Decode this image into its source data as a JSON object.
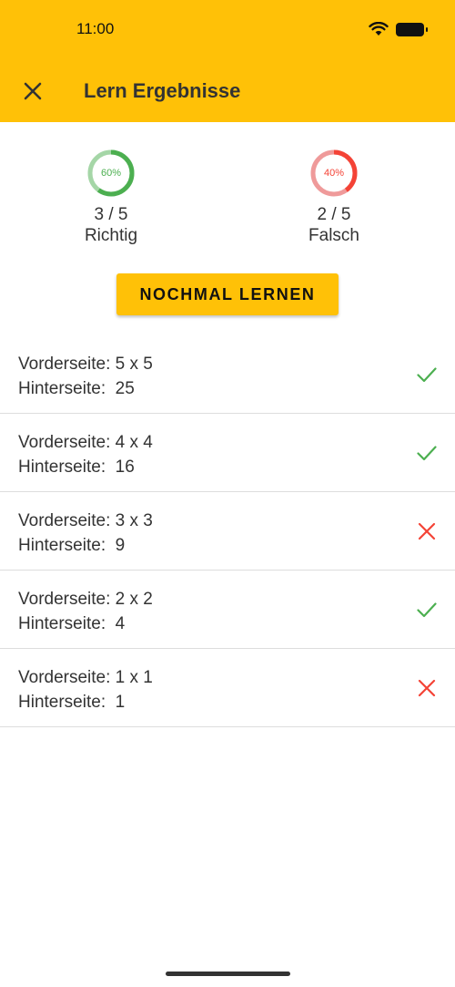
{
  "status_bar": {
    "time": "11:00"
  },
  "app_bar": {
    "title": "Lern Ergebnisse",
    "close_icon": "close-icon",
    "background": "#FFC107"
  },
  "stats": {
    "correct": {
      "percent_label": "60%",
      "percent": 60,
      "count": "3 / 5",
      "label": "Richtig",
      "color": "#4CAF50",
      "track": "#A5D6A7"
    },
    "wrong": {
      "percent_label": "40%",
      "percent": 40,
      "count": "2 / 5",
      "label": "Falsch",
      "color": "#F44336",
      "track": "#EF9A9A"
    }
  },
  "relearn_button": {
    "label": "NOCHMAL LERNEN"
  },
  "cards": [
    {
      "front": "Vorderseite: 5 x 5",
      "back": "Hinterseite:  25",
      "correct": true
    },
    {
      "front": "Vorderseite: 4 x 4",
      "back": "Hinterseite:  16",
      "correct": true
    },
    {
      "front": "Vorderseite: 3 x 3",
      "back": "Hinterseite:  9",
      "correct": false
    },
    {
      "front": "Vorderseite: 2 x 2",
      "back": "Hinterseite:  4",
      "correct": true
    },
    {
      "front": "Vorderseite: 1 x 1",
      "back": "Hinterseite:  1",
      "correct": false
    }
  ],
  "colors": {
    "check": "#4CAF50",
    "cross": "#F44336"
  }
}
